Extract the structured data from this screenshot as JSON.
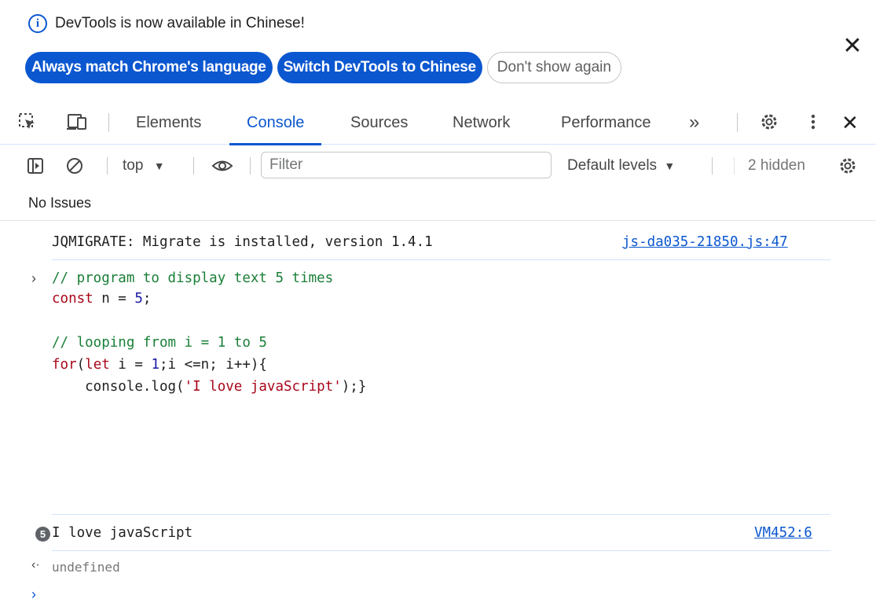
{
  "infobar": {
    "icon": "info-icon",
    "message": "DevTools is now available in Chinese!",
    "buttons": [
      "Always match Chrome's language",
      "Switch DevTools to Chinese",
      "Don't show again"
    ],
    "close_glyph": "✕"
  },
  "tabs": {
    "items": [
      "Elements",
      "Console",
      "Sources",
      "Network",
      "Performance"
    ],
    "active": "Console",
    "more_glyph": "»",
    "close_glyph": "✕"
  },
  "toolbar": {
    "context": "top",
    "filter_placeholder": "Filter",
    "levels": "Default levels",
    "hidden": "2 hidden"
  },
  "issues": {
    "text": "No Issues"
  },
  "console": {
    "migrate_message": "JQMIGRATE: Migrate is installed, version 1.4.1",
    "migrate_source": "js-da035-21850.js:47",
    "input_prompt": "›",
    "code_lines": [
      "// program to display text 5 times",
      "const n = 5;",
      "",
      "// looping from i = 1 to 5",
      "for(let i = 1;i <=n; i++){",
      "    console.log('I love javaScript');}"
    ],
    "log_count": "5",
    "log_message": "I love javaScript",
    "log_source": "VM452:6",
    "result_prompt": "‹·",
    "result": "undefined",
    "next_prompt": "›"
  },
  "colors": {
    "accent": "#0b57d0",
    "link": "#0b57d0",
    "comment": "#1a7f37",
    "keyword": "#a8071a",
    "number": "#1a1aa6"
  }
}
